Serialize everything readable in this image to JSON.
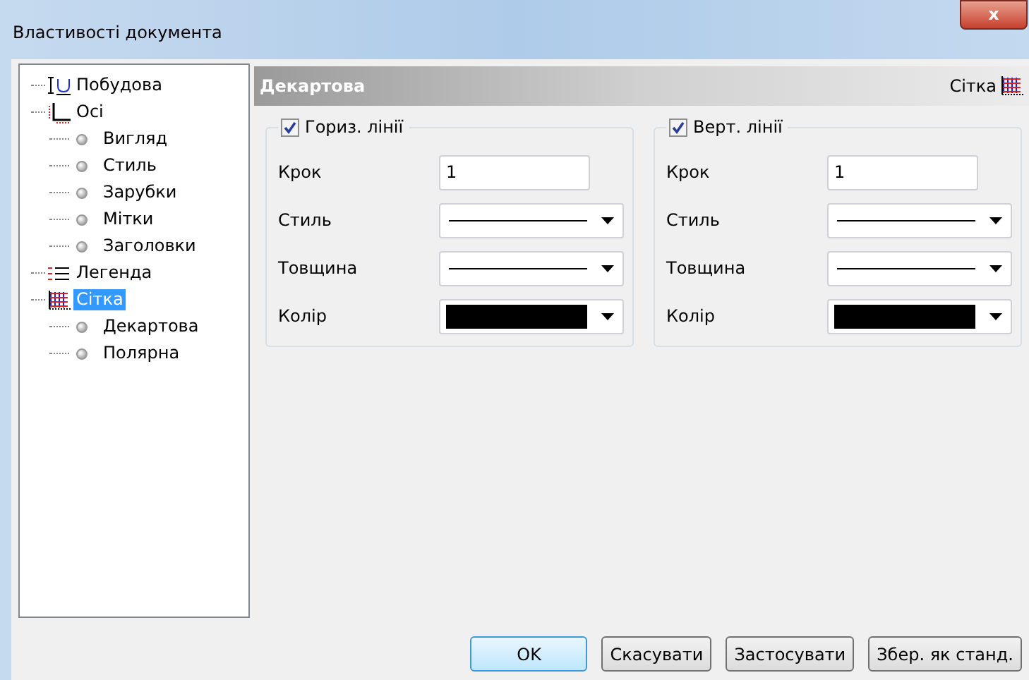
{
  "window": {
    "title": "Властивості документа",
    "close": "x"
  },
  "tree": [
    {
      "label": "Побудова",
      "kind": "plot",
      "selected": false
    },
    {
      "label": "Осі",
      "kind": "axes",
      "selected": false,
      "children": [
        {
          "label": "Вигляд",
          "kind": "bullet",
          "selected": false
        },
        {
          "label": "Стиль",
          "kind": "bullet",
          "selected": false
        },
        {
          "label": "Зарубки",
          "kind": "bullet",
          "selected": false
        },
        {
          "label": "Мітки",
          "kind": "bullet",
          "selected": false
        },
        {
          "label": "Заголовки",
          "kind": "bullet",
          "selected": false
        }
      ]
    },
    {
      "label": "Легенда",
      "kind": "legend",
      "selected": false
    },
    {
      "label": "Сітка",
      "kind": "grid",
      "selected": true,
      "children": [
        {
          "label": "Декартова",
          "kind": "bullet",
          "selected": false
        },
        {
          "label": "Полярна",
          "kind": "bullet",
          "selected": false
        }
      ]
    }
  ],
  "header": {
    "title": "Декартова",
    "section": "Сітка"
  },
  "groups": [
    {
      "title": "Гориз. лінії",
      "checked": true,
      "rows": [
        {
          "kind": "text",
          "label": "Крок",
          "value": "1"
        },
        {
          "kind": "line",
          "label": "Стиль"
        },
        {
          "kind": "line",
          "label": "Товщина"
        },
        {
          "kind": "color",
          "label": "Колір",
          "color": "#000000"
        }
      ]
    },
    {
      "title": "Верт. лінії",
      "checked": true,
      "rows": [
        {
          "kind": "text",
          "label": "Крок",
          "value": "1"
        },
        {
          "kind": "line",
          "label": "Стиль"
        },
        {
          "kind": "line",
          "label": "Товщина"
        },
        {
          "kind": "color",
          "label": "Колір",
          "color": "#000000"
        }
      ]
    }
  ],
  "buttons": [
    {
      "label": "OK",
      "default": true
    },
    {
      "label": "Скасувати",
      "default": false
    },
    {
      "label": "Застосувати",
      "default": false
    },
    {
      "label": "Збер. як станд.",
      "default": false
    }
  ]
}
